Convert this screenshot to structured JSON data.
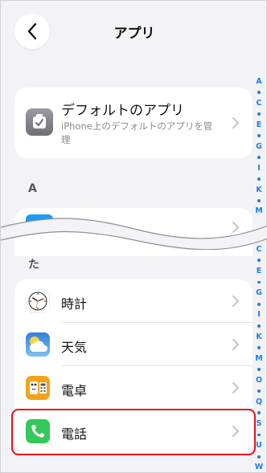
{
  "nav": {
    "title": "アプリ",
    "back_icon": "chevron-left-icon"
  },
  "default_apps": {
    "title": "デフォルトのアプリ",
    "description": "iPhone上のデフォルトのアプリを管理",
    "icon": "checkmark-badge-icon"
  },
  "sections": {
    "a": "A",
    "ta": "た"
  },
  "apps": [
    {
      "name": "時計",
      "icon": "clock-icon"
    },
    {
      "name": "天気",
      "icon": "weather-icon"
    },
    {
      "name": "電卓",
      "icon": "calculator-icon"
    },
    {
      "name": "電話",
      "icon": "phone-icon",
      "highlighted": true
    }
  ],
  "index_top": [
    "A",
    "C",
    "E",
    "G",
    "I",
    "K",
    "M"
  ],
  "index_bottom": [
    "C",
    "E",
    "G",
    "I",
    "K",
    "M",
    "O",
    "Q",
    "S",
    "U",
    "W"
  ],
  "colors": {
    "accent_blue": "#1c7cf0",
    "highlight_red": "#e8121d",
    "phone_green": "#34c759",
    "background": "#f2f2f7"
  }
}
